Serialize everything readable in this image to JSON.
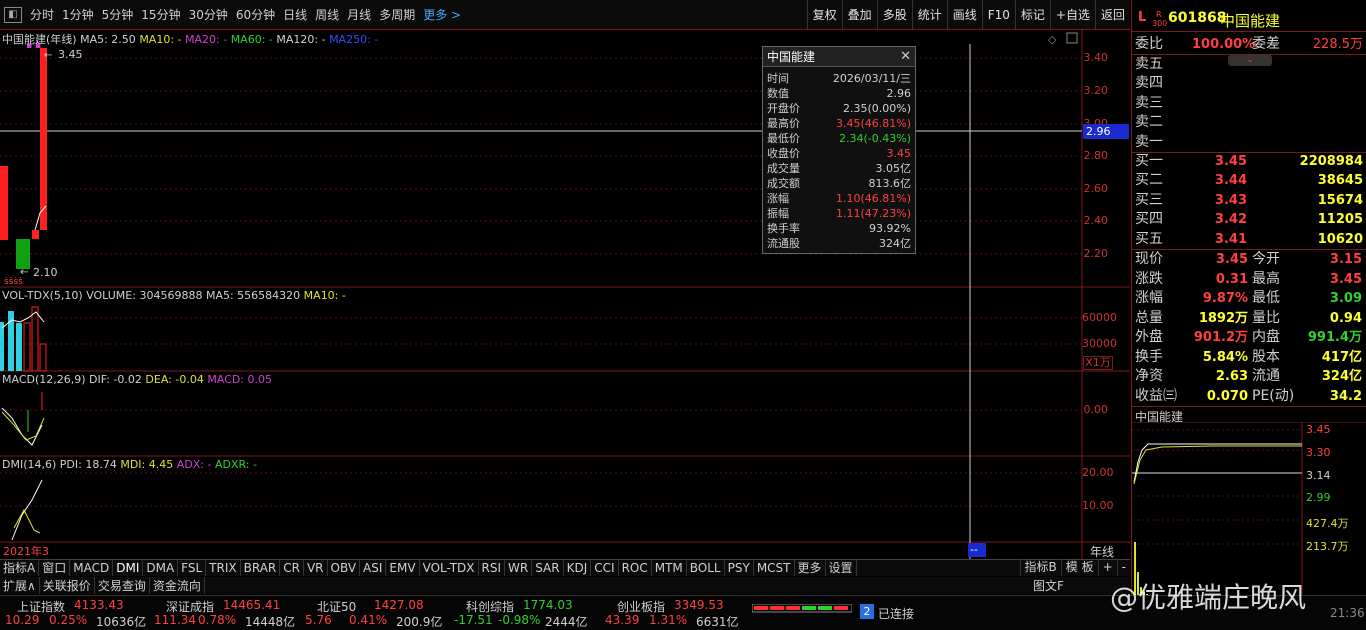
{
  "toolbar": {
    "periods": [
      "分时",
      "1分钟",
      "5分钟",
      "15分钟",
      "30分钟",
      "60分钟",
      "日线",
      "周线",
      "月线",
      "多周期"
    ],
    "more": "更多 >",
    "right_buttons": [
      "复权",
      "叠加",
      "多股",
      "统计",
      "画线",
      "F10",
      "标记",
      "+自选",
      "返回"
    ]
  },
  "main_chart": {
    "title": "中国能建(年线)",
    "ma5": "MA5: 2.50",
    "ma10": "MA10: -",
    "ma20": "MA20: -",
    "ma60": "MA60: -",
    "ma120": "MA120: -",
    "ma250": "MA250: -",
    "high_label": "3.45",
    "low_label": "2.10",
    "y_ticks": [
      "3.40",
      "3.20",
      "3.00",
      "2.80",
      "2.60",
      "2.40",
      "2.20"
    ],
    "crosshair_value": "2.96"
  },
  "vol_chart": {
    "title": "VOL-TDX(5,10)",
    "volume": "VOLUME: 304569888",
    "ma5": "MA5: 556584320",
    "ma10": "MA10: -",
    "y_ticks": [
      "60000",
      "30000"
    ],
    "unit": "X1万"
  },
  "macd_chart": {
    "title": "MACD(12,26,9)",
    "dif": "DIF: -0.02",
    "dea": "DEA: -0.04",
    "macd": "MACD: 0.05",
    "y_ticks": [
      "0.00"
    ]
  },
  "dmi_chart": {
    "title": "DMI(14,6)",
    "pdi": "PDI: 18.74",
    "mdi": "MDI: 4.45",
    "adx": "ADX: -",
    "adxr": "ADXR: -",
    "y_ticks": [
      "20.00",
      "10.00"
    ],
    "x_label": "2021年3",
    "x_marker": "--",
    "period_label": "年线"
  },
  "popup": {
    "title": "中国能建",
    "rows": [
      {
        "k": "时间",
        "v": "2026/03/11/三",
        "c": "#d0d0d0"
      },
      {
        "k": "数值",
        "v": "2.96",
        "c": "#d0d0d0"
      },
      {
        "k": "开盘价",
        "v": "2.35(0.00%)",
        "c": "#d0d0d0"
      },
      {
        "k": "最高价",
        "v": "3.45(46.81%)",
        "c": "#ff4040"
      },
      {
        "k": "最低价",
        "v": "2.34(-0.43%)",
        "c": "#30d030"
      },
      {
        "k": "收盘价",
        "v": "3.45",
        "c": "#ff4040"
      },
      {
        "k": "成交量",
        "v": "3.05亿",
        "c": "#d0d0d0"
      },
      {
        "k": "成交额",
        "v": "813.6亿",
        "c": "#d0d0d0"
      },
      {
        "k": "涨幅",
        "v": "1.10(46.81%)",
        "c": "#ff4040"
      },
      {
        "k": "振幅",
        "v": "1.11(47.23%)",
        "c": "#ff4040"
      },
      {
        "k": "换手率",
        "v": "93.92%",
        "c": "#d0d0d0"
      },
      {
        "k": "流通股",
        "v": "324亿",
        "c": "#d0d0d0"
      }
    ]
  },
  "quote": {
    "badge_l": "L",
    "badge_r": "R",
    "badge_300": "300",
    "code": "601868",
    "name": "中国能建",
    "webi_label": "委比",
    "webi": "100.00%",
    "weicha_label": "委差",
    "weicha": "228.5万",
    "asks": [
      {
        "label": "卖五",
        "price": "",
        "vol": ""
      },
      {
        "label": "卖四",
        "price": "",
        "vol": ""
      },
      {
        "label": "卖三",
        "price": "",
        "vol": ""
      },
      {
        "label": "卖二",
        "price": "",
        "vol": ""
      },
      {
        "label": "卖一",
        "price": "",
        "vol": ""
      }
    ],
    "bids": [
      {
        "label": "买一",
        "price": "3.45",
        "vol": "2208984"
      },
      {
        "label": "买二",
        "price": "3.44",
        "vol": "38645"
      },
      {
        "label": "买三",
        "price": "3.43",
        "vol": "15674"
      },
      {
        "label": "买四",
        "price": "3.42",
        "vol": "11205"
      },
      {
        "label": "买五",
        "price": "3.41",
        "vol": "10620"
      }
    ],
    "stats": [
      {
        "k1": "现价",
        "v1": "3.45",
        "c1": "#ff4040",
        "k2": "今开",
        "v2": "3.15",
        "c2": "#ff4040"
      },
      {
        "k1": "涨跌",
        "v1": "0.31",
        "c1": "#ff4040",
        "k2": "最高",
        "v2": "3.45",
        "c2": "#ff4040"
      },
      {
        "k1": "涨幅",
        "v1": "9.87%",
        "c1": "#ff4040",
        "k2": "最低",
        "v2": "3.09",
        "c2": "#30d030"
      },
      {
        "k1": "总量",
        "v1": "1892万",
        "c1": "#ffff30",
        "k2": "量比",
        "v2": "0.94",
        "c2": "#ffff30"
      },
      {
        "k1": "外盘",
        "v1": "901.2万",
        "c1": "#ff4040",
        "k2": "内盘",
        "v2": "991.4万",
        "c2": "#30d030"
      },
      {
        "k1": "换手",
        "v1": "5.84%",
        "c1": "#ffff30",
        "k2": "股本",
        "v2": "417亿",
        "c2": "#ffff30"
      },
      {
        "k1": "净资",
        "v1": "2.63",
        "c1": "#ffff30",
        "k2": "流通",
        "v2": "324亿",
        "c2": "#ffff30"
      },
      {
        "k1": "收益㈢",
        "v1": "0.070",
        "c1": "#ffff30",
        "k2": "PE(动)",
        "v2": "34.2",
        "c2": "#ffff30"
      }
    ],
    "mini_title": "中国能建",
    "mini_ticks": [
      "3.45",
      "3.30",
      "3.14",
      "2.99"
    ],
    "mini_vol_ticks": [
      "427.4万",
      "213.7万"
    ]
  },
  "indicator_tabs": [
    "指标A",
    "窗口",
    "MACD",
    "DMI",
    "DMA",
    "FSL",
    "TRIX",
    "BRAR",
    "CR",
    "VR",
    "OBV",
    "ASI",
    "EMV",
    "VOL-TDX",
    "RSI",
    "WR",
    "SAR",
    "KDJ",
    "CCI",
    "ROC",
    "MTM",
    "BOLL",
    "PSY",
    "MCST",
    "更多",
    "设置"
  ],
  "indicator_right": [
    "指标B",
    "模 板",
    "+",
    "-"
  ],
  "bottom_tabs": [
    "扩展∧",
    "关联报价",
    "交易查询",
    "资金流向"
  ],
  "bottom_right": "图文F",
  "status": {
    "indices": [
      {
        "name": "上证指数",
        "val": "4133.43",
        "chg": "10.29",
        "pct": "0.25%",
        "amt": "10636亿",
        "color": "#ff4040"
      },
      {
        "name": "深证成指",
        "val": "14465.41",
        "chg": "111.34",
        "pct": "0.78%",
        "amt": "14448亿",
        "color": "#ff4040"
      },
      {
        "name": "北证50",
        "val": "1427.08",
        "chg": "5.76",
        "pct": "0.41%",
        "amt": "200.9亿",
        "color": "#ff4040"
      },
      {
        "name": "科创综指",
        "val": "1774.03",
        "chg": "-17.51",
        "pct": "-0.98%",
        "amt": "2444亿",
        "color": "#30d030"
      },
      {
        "name": "创业板指",
        "val": "3349.53",
        "chg": "43.39",
        "pct": "1.31%",
        "amt": "6631亿",
        "color": "#ff4040"
      }
    ],
    "conn_num": "2",
    "conn": "已连接",
    "time": "21:36",
    "watermark": "@优雅端庄晚风"
  }
}
